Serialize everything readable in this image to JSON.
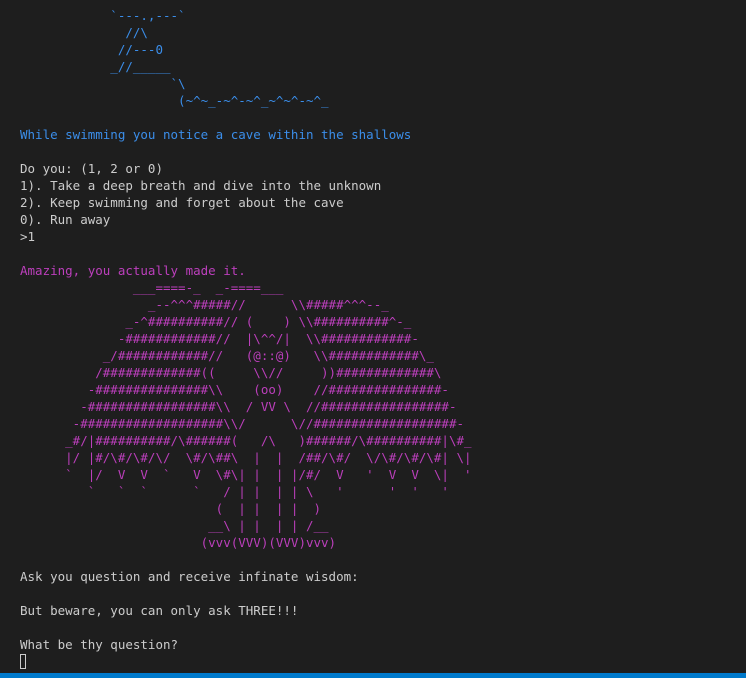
{
  "colors": {
    "background": "#1e1e1e",
    "text": "#cccccc",
    "blue": "#3b8eea",
    "magenta": "#bc3fbc",
    "status_bar": "#007acc"
  },
  "swimmer_art": "            `---.,---`\n              //\\\n             //---0\n            _//_____\n                    `\\\n                     (~^~_-~^-~^_~^~^-~^_",
  "cave_notice": "While swimming you notice a cave within the shallows",
  "prompt": {
    "question": "Do you: (1, 2 or 0)",
    "options": [
      "1). Take a deep breath and dive into the unknown",
      "2). Keep swimming and forget about the cave",
      "0). Run away"
    ],
    "input": ">1"
  },
  "amazing_text": "Amazing, you actually made it.",
  "creature_art": "               ___====-_  _-====___\n                 _--^^^#####//      \\\\#####^^^--_\n              _-^##########// (    ) \\\\##########^-_\n             -############//  |\\^^/|  \\\\############-\n           _/############//   (@::@)   \\\\############\\_\n          /#############((     \\\\//     ))#############\\\n         -###############\\\\    (oo)    //###############-\n        -#################\\\\  / VV \\  //#################-\n       -###################\\\\/      \\//###################-\n      _#/|##########/\\######(   /\\   )######/\\##########|\\#_\n      |/ |#/\\#/\\#/\\/  \\#/\\##\\  |  |  /##/\\#/  \\/\\#/\\#/\\#| \\|\n      `  |/  V  V  `   V  \\#\\| |  | |/#/  V   '  V  V  \\|  '\n         `   `  `      `   / | |  | | \\   '      '  '   '\n                          (  | |  | |  )\n                         __\\ | |  | | /__\n                        (vvv(VVV)(VVV)vvv)",
  "ask_text": "Ask you question and receive infinate wisdom:",
  "beware_text": "But beware, you can only ask THREE!!!",
  "question_prompt": "What be thy question?"
}
